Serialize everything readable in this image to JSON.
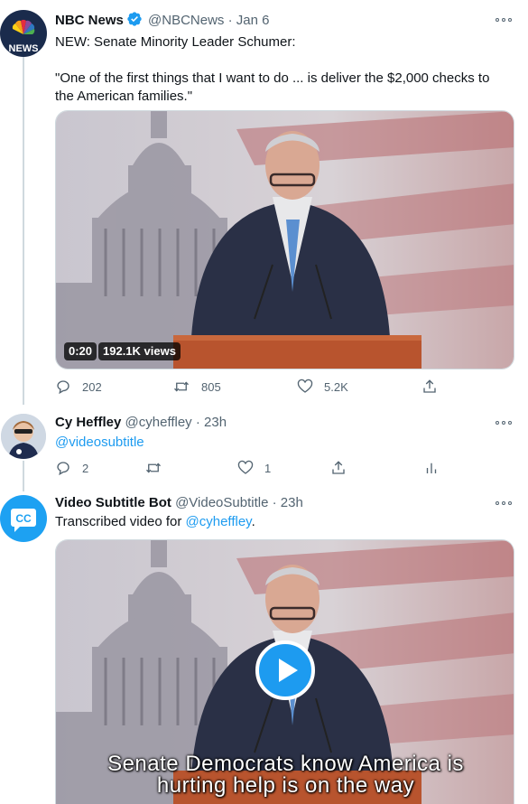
{
  "tweets": [
    {
      "name": "NBC News",
      "handle": "@NBCNews",
      "separator": "·",
      "time": "Jan 6",
      "verified": true,
      "avatar_label": "NEWS",
      "text_line1": "NEW: Senate Minority Leader Schumer:",
      "text_line2": "\"One of the first things that I want to do ... is deliver the $2,000 checks to",
      "text_line3": "the American families.\"",
      "media": {
        "duration": "0:20",
        "views": "192.1K views"
      },
      "actions": {
        "replies": "202",
        "retweets": "805",
        "likes": "5.2K"
      }
    },
    {
      "name": "Cy Heffley",
      "handle": "@cyheffley",
      "separator": "·",
      "time": "23h",
      "text_mention": "@videosubtitle",
      "actions": {
        "replies": "2",
        "retweets": "",
        "likes": "1"
      }
    },
    {
      "name": "Video Subtitle Bot",
      "handle": "@VideoSubtitle",
      "separator": "·",
      "time": "23h",
      "avatar_label": "CC",
      "text_prefix": "Transcribed video for ",
      "text_mention": "@cyheffley",
      "text_suffix": ".",
      "media": {
        "caption_line1": "Senate Democrats know America is",
        "caption_line2": "hurting help is on the way"
      }
    }
  ],
  "colors": {
    "link": "#1d9bf0",
    "muted": "#536471",
    "border": "#cfd9de",
    "bot_avatar": "#1da1f2",
    "nbc_avatar": "#1a2b4c"
  }
}
